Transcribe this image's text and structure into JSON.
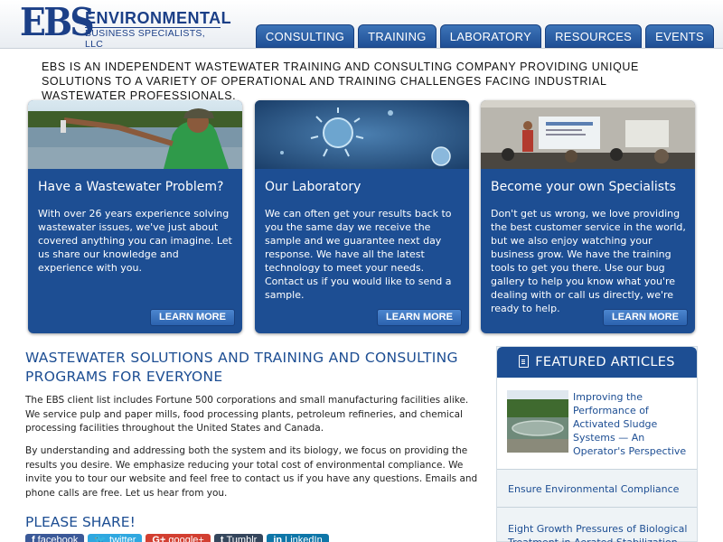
{
  "logo": {
    "mark": "EBS",
    "line1": "ENVIRONMENTAL",
    "line2": "BUSINESS SPECIALISTS, LLC"
  },
  "nav": [
    "CONSULTING",
    "TRAINING",
    "LABORATORY",
    "RESOURCES",
    "EVENTS"
  ],
  "intro": "EBS is an independent wastewater training and consulting company providing unique solutions to a variety of operational and training challenges facing industrial wastewater professionals.",
  "cards": [
    {
      "title": "Have a Wastewater Problem?",
      "body": "With over 26 years experience solving wastewater issues, we've just about covered anything you can imagine. Let us share our knowledge and experience with you.",
      "button": "LEARN MORE"
    },
    {
      "title": "Our Laboratory",
      "body": "We can often get your results back to you the same day we receive the sample and we guarantee next day response. We have all the latest technology to meet your needs. Contact us if you would like to send a sample.",
      "button": "LEARN MORE"
    },
    {
      "title": "Become your own Specialists",
      "body": "Don't get us wrong, we love providing the best customer service in the world, but we also enjoy watching your business grow. We have the training tools to get you there. Use our bug gallery to help you know what you're dealing with or call us directly, we're ready to help.",
      "button": "LEARN MORE"
    }
  ],
  "main": {
    "title": "WASTEWATER SOLUTIONS AND TRAINING AND CONSULTING PROGRAMS FOR EVERYONE",
    "para1": "The EBS client list includes Fortune 500 corporations and small manufacturing facilities alike. We service pulp and paper mills, food processing plants, petroleum refineries, and chemical processing facilities throughout the United States and Canada.",
    "para2": "By understanding and addressing both the system and its biology, we focus on providing the results you desire. We emphasize reducing your total cost of environmental compliance. We invite you to tour our website and feel free to contact us if you have any questions. Emails and phone calls are free. Let us hear from you.",
    "share_title": "PLEASE SHARE!"
  },
  "share": [
    {
      "icon": "f",
      "label": "facebook",
      "color": "#3b5998"
    },
    {
      "icon": "🐦",
      "label": "twitter",
      "color": "#2fa8e0"
    },
    {
      "icon": "G+",
      "label": "google+",
      "color": "#d23f31"
    },
    {
      "icon": "t",
      "label": "Tumblr",
      "color": "#35465c"
    },
    {
      "icon": "in",
      "label": "LinkedIn",
      "color": "#0e76a8"
    }
  ],
  "sidebar": {
    "title": "FEATURED ARTICLES",
    "articles": [
      "Improving the Performance of Activated Sludge Systems — An Operator's Perspective",
      "Ensure Environmental Compliance",
      "Eight Growth Pressures of Biological Treatment in Aerated Stabilization"
    ]
  }
}
